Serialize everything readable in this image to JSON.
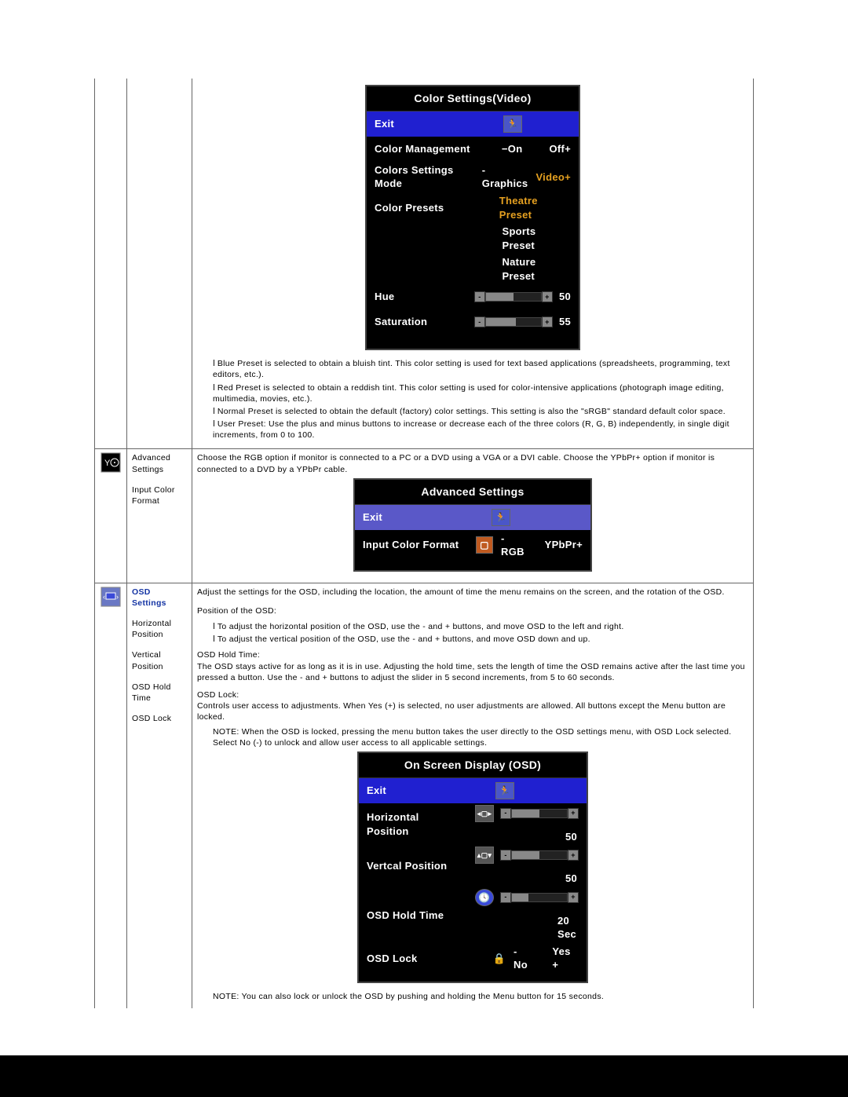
{
  "panel_color": {
    "title": "Color Settings(Video)",
    "exit": "Exit",
    "rows": {
      "color_mgmt": {
        "label": "Color Management",
        "on": "−On",
        "off": "Off+"
      },
      "mode": {
        "label": "Colors Settings Mode",
        "graphics": "-Graphics",
        "video": "Video+"
      },
      "presets_label": "Color Presets",
      "presets": {
        "theatre": "Theatre Preset",
        "sports": "Sports Preset",
        "nature": "Nature Preset"
      },
      "hue": {
        "label": "Hue",
        "value": "50"
      },
      "saturation": {
        "label": "Saturation",
        "value": "55"
      }
    }
  },
  "text_color_bullets": {
    "b1": "Blue Preset is selected to obtain a bluish tint. This color setting is used for text based applications (spreadsheets, programming, text editors, etc.).",
    "b2": "Red Preset is selected to obtain a reddish tint. This color setting is used for color-intensive applications (photograph image editing, multimedia, movies, etc.).",
    "b3": "Normal Preset is selected to obtain the default (factory) color settings. This setting is also the \"sRGB\" standard default color space.",
    "b4": "User Preset: Use the plus and minus buttons to increase or decrease each of the three colors (R, G, B) independently, in single digit increments, from 0 to 100."
  },
  "advanced": {
    "label_title": "Advanced Settings",
    "label_sub": "Input Color Format",
    "intro": "Choose the RGB option if monitor is connected to a PC or a DVD using a VGA or a DVI cable. Choose the YPbPr+ option if monitor is connected to a DVD by a YPbPr cable.",
    "panel": {
      "title": "Advanced Settings",
      "exit": "Exit",
      "row": {
        "label": "Input Color Format",
        "rgb": "-RGB",
        "ypbpr": "YPbPr+"
      }
    }
  },
  "osd_section": {
    "title": "OSD Settings",
    "sub": {
      "h": "Horizontal Position",
      "v": "Vertical Position",
      "hold": "OSD Hold Time",
      "lock": "OSD Lock"
    },
    "intro": "Adjust the settings for the OSD, including the location, the amount of time the menu remains on the screen, and the rotation of the OSD.",
    "pos_heading": "Position of the OSD:",
    "b_h": "To adjust the horizontal position of the OSD, use the - and + buttons, and move OSD to the left and right.",
    "b_v": "To adjust the vertical position of the OSD, use the - and + buttons, and move OSD down and up.",
    "hold_heading": "OSD Hold Time:",
    "hold_text": "The OSD stays active for as long as it is in use. Adjusting the hold time, sets the length of time the OSD remains active after the last time you pressed a button. Use the - and + buttons to adjust the slider in 5 second increments, from 5 to 60 seconds.",
    "lock_heading": "OSD Lock:",
    "lock_text": "Controls user access to adjustments. When Yes (+) is selected, no user adjustments are allowed. All buttons except the Menu button are locked.",
    "lock_note": "NOTE: When the OSD is locked, pressing the menu button takes the user directly to the OSD settings menu, with OSD Lock selected. Select No (-) to unlock and allow user access to all applicable settings.",
    "panel": {
      "title": "On Screen Display (OSD)",
      "exit": "Exit",
      "rows": {
        "h": {
          "label": "Horizontal Position",
          "value": "50"
        },
        "v": {
          "label": "Vertcal Position",
          "value": "50"
        },
        "hold": {
          "label": "OSD Hold Time",
          "value": "20 Sec"
        },
        "lock": {
          "label": "OSD Lock",
          "no": "-  No",
          "yes": "Yes +"
        }
      }
    },
    "footer_note": "NOTE: You can also lock or unlock the OSD by pushing and holding the Menu button for 15 seconds."
  }
}
